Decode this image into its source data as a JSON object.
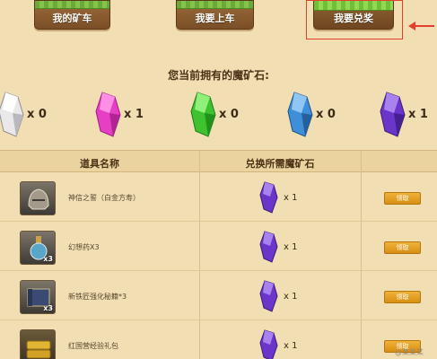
{
  "tabs": [
    {
      "label": "我的矿车",
      "active": false
    },
    {
      "label": "我要上车",
      "active": false
    },
    {
      "label": "我要兑奖",
      "active": true
    }
  ],
  "owned": {
    "title": "您当前拥有的魔矿石:",
    "stones": [
      {
        "color": "white",
        "count": "x 0"
      },
      {
        "color": "pink",
        "count": "x 1"
      },
      {
        "color": "green",
        "count": "x 0"
      },
      {
        "color": "blue",
        "count": "x 0"
      },
      {
        "color": "purple",
        "count": "x 1"
      }
    ]
  },
  "table": {
    "headers": {
      "name": "道具名称",
      "cost": "兑换所需魔矿石"
    },
    "rows": [
      {
        "icon": "helmet-icon",
        "name": "神信之誓（白金方寿）",
        "badge": "",
        "cost": "x 1",
        "action": "领取"
      },
      {
        "icon": "potion-icon",
        "name": "幻想药X3",
        "badge": "x3",
        "cost": "x 1",
        "action": "领取"
      },
      {
        "icon": "book-icon",
        "name": "新铁匠强化秘籍*3",
        "badge": "x3",
        "cost": "x 1",
        "action": "领取"
      },
      {
        "icon": "gold-bar-icon",
        "name": "红国营经验礼包",
        "badge": "",
        "cost": "x 1",
        "action": "领取"
      }
    ]
  },
  "watermark": "@某某某",
  "colors": {
    "background": "#f1dfb3",
    "tab_brown": "#7a4f27",
    "grass": "#86c34a",
    "highlight": "#e0402c",
    "claim": "#e0a020"
  }
}
